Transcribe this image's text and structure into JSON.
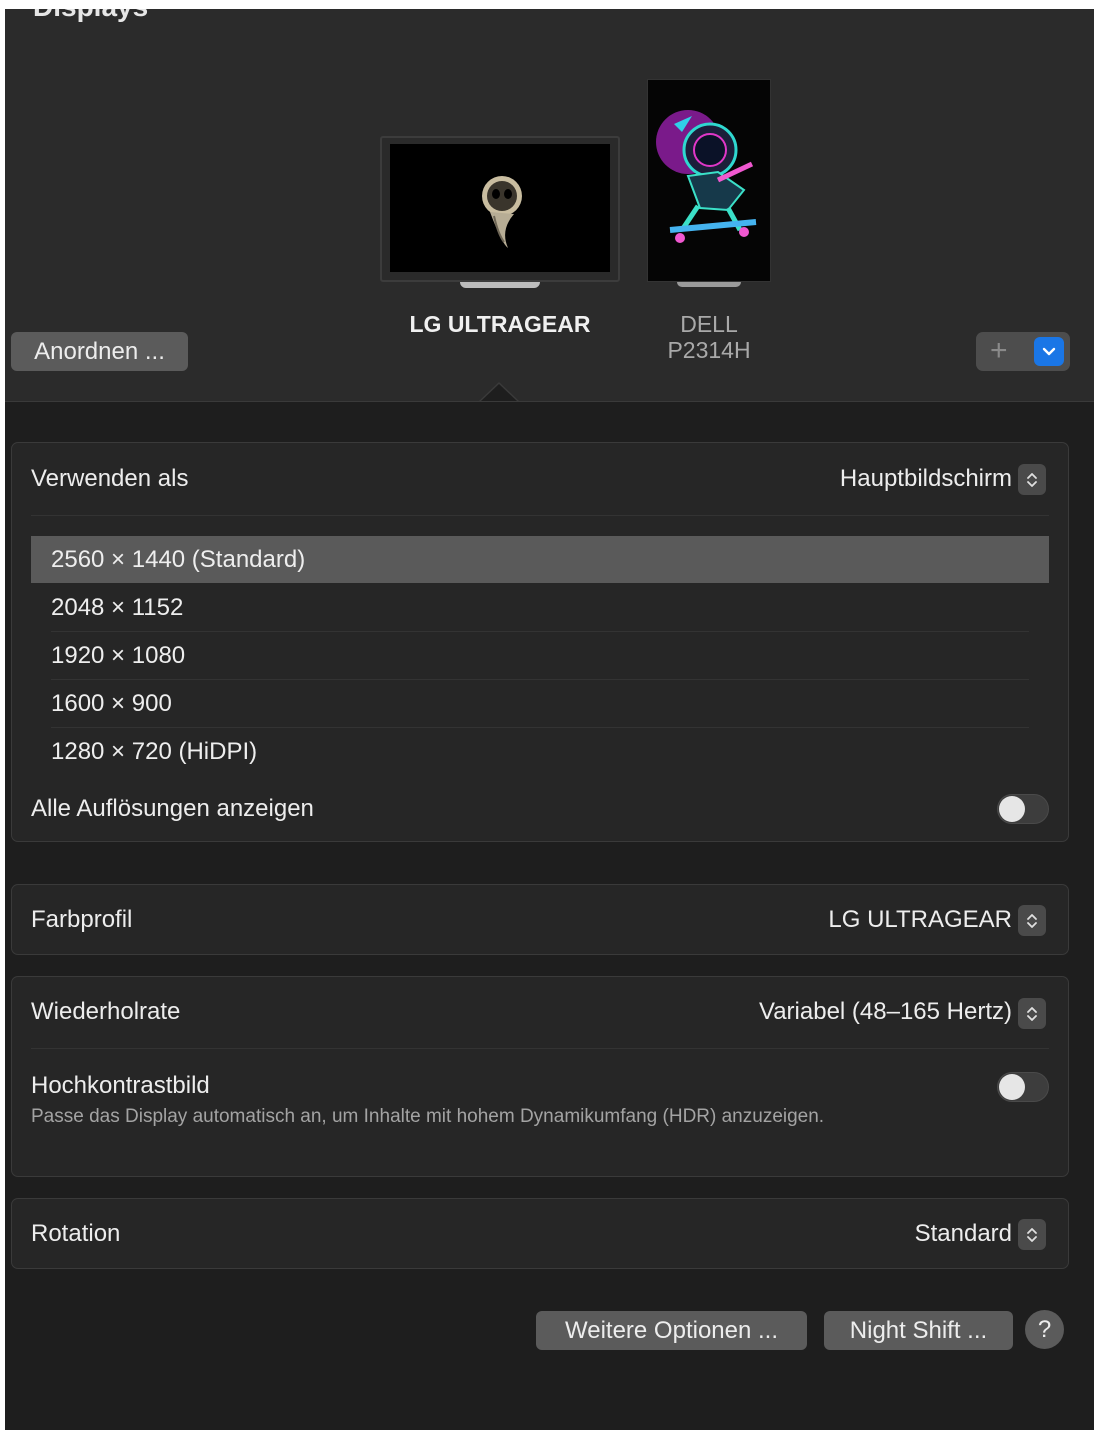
{
  "window": {
    "title": "Displays"
  },
  "arrangement": {
    "arrange_button": "Anordnen ...",
    "displays": [
      {
        "name": "LG ULTRAGEAR",
        "active": true
      },
      {
        "name_line1": "DELL",
        "name_line2": "P2314H",
        "active": false
      }
    ],
    "add_button_icon": "plus-icon",
    "menu_button_icon": "chevron-down-icon"
  },
  "usage": {
    "label": "Verwenden als",
    "value": "Hauptbildschirm"
  },
  "resolutions": {
    "items": [
      {
        "label": "2560 × 1440 (Standard)",
        "selected": true
      },
      {
        "label": "2048 × 1152",
        "selected": false
      },
      {
        "label": "1920 × 1080",
        "selected": false
      },
      {
        "label": "1600 × 900",
        "selected": false
      },
      {
        "label": "1280 × 720 (HiDPI)",
        "selected": false
      }
    ],
    "show_all_label": "Alle Auflösungen anzeigen",
    "show_all_enabled": false
  },
  "color_profile": {
    "label": "Farbprofil",
    "value": "LG ULTRAGEAR"
  },
  "refresh": {
    "label": "Wiederholrate",
    "value": "Variabel (48–165 Hertz)"
  },
  "hdr": {
    "label": "Hochkontrastbild",
    "description": "Passe das Display automatisch an, um Inhalte mit hohem Dynamikumfang (HDR) anzuzeigen.",
    "enabled": false
  },
  "rotation": {
    "label": "Rotation",
    "value": "Standard"
  },
  "footer": {
    "more_options": "Weitere Optionen ...",
    "night_shift": "Night Shift ...",
    "help": "?"
  },
  "colors": {
    "background": "#1e1e1e",
    "header": "#2b2b2b",
    "accent": "#1a76e6",
    "selected_row": "#5a5a5a"
  }
}
